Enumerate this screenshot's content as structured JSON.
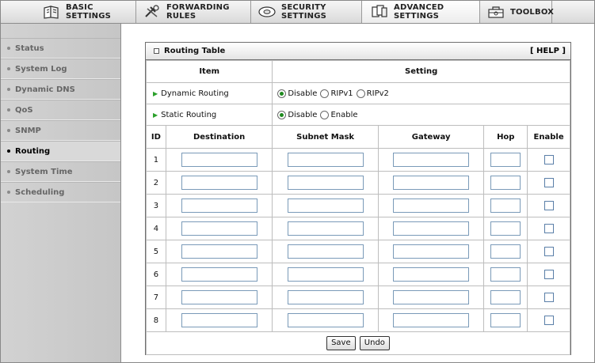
{
  "tabs": [
    {
      "label": "BASIC SETTINGS",
      "icon": "book-icon"
    },
    {
      "label": "FORWARDING RULES",
      "icon": "tools-icon"
    },
    {
      "label": "SECURITY SETTINGS",
      "icon": "disc-icon"
    },
    {
      "label": "ADVANCED SETTINGS",
      "icon": "pages-icon",
      "active": true
    },
    {
      "label": "TOOLBOX",
      "icon": "toolbox-icon"
    }
  ],
  "sidebar": {
    "items": [
      {
        "label": "Status"
      },
      {
        "label": "System Log"
      },
      {
        "label": "Dynamic DNS"
      },
      {
        "label": "QoS"
      },
      {
        "label": "SNMP"
      },
      {
        "label": "Routing",
        "active": true
      },
      {
        "label": "System Time"
      },
      {
        "label": "Scheduling"
      }
    ]
  },
  "panel": {
    "title": "Routing Table",
    "help": "[ HELP ]",
    "item_header": "Item",
    "setting_header": "Setting",
    "dynamic_routing": {
      "label": "Dynamic Routing",
      "options": [
        "Disable",
        "RIPv1",
        "RIPv2"
      ],
      "selected": "Disable"
    },
    "static_routing": {
      "label": "Static Routing",
      "options": [
        "Disable",
        "Enable"
      ],
      "selected": "Disable"
    },
    "columns": [
      "ID",
      "Destination",
      "Subnet Mask",
      "Gateway",
      "Hop",
      "Enable"
    ],
    "rows": [
      {
        "id": "1"
      },
      {
        "id": "2"
      },
      {
        "id": "3"
      },
      {
        "id": "4"
      },
      {
        "id": "5"
      },
      {
        "id": "6"
      },
      {
        "id": "7"
      },
      {
        "id": "8"
      }
    ],
    "buttons": {
      "save": "Save",
      "undo": "Undo"
    }
  },
  "colors": {
    "radio_checked": "#1f8a1f",
    "input_border": "#7a9ab8"
  }
}
